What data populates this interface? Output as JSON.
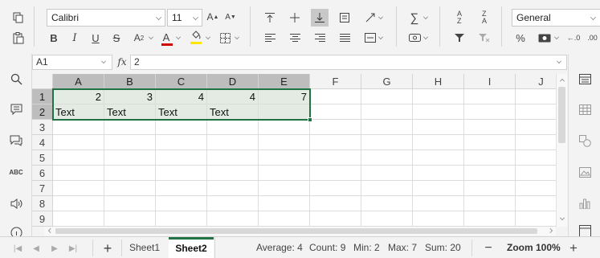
{
  "toolbar": {
    "font_name": "Calibri",
    "font_size": "11",
    "number_format": "General"
  },
  "formula_bar": {
    "name_box": "A1",
    "fx_label": "fx",
    "formula": "2"
  },
  "columns": [
    "A",
    "B",
    "C",
    "D",
    "E",
    "F",
    "G",
    "H",
    "I",
    "J"
  ],
  "rows": [
    "1",
    "2",
    "3",
    "4",
    "5",
    "6",
    "7",
    "8",
    "9"
  ],
  "cells": {
    "row1": [
      "2",
      "3",
      "4",
      "4",
      "7"
    ],
    "row2": [
      "Text",
      "Text",
      "Text",
      "Text",
      ""
    ]
  },
  "sheets": {
    "tabs": [
      "Sheet1",
      "Sheet2"
    ],
    "active": "Sheet2"
  },
  "status": {
    "average": "Average: 4",
    "count": "Count: 9",
    "min": "Min: 2",
    "max": "Max: 7",
    "sum": "Sum: 20",
    "zoom": "Zoom 100%"
  },
  "colors": {
    "accent": "#217346",
    "selection_fill": "#e3ebe3",
    "font_color_bar": "#d00000",
    "fill_color_bar": "#ffe600"
  }
}
